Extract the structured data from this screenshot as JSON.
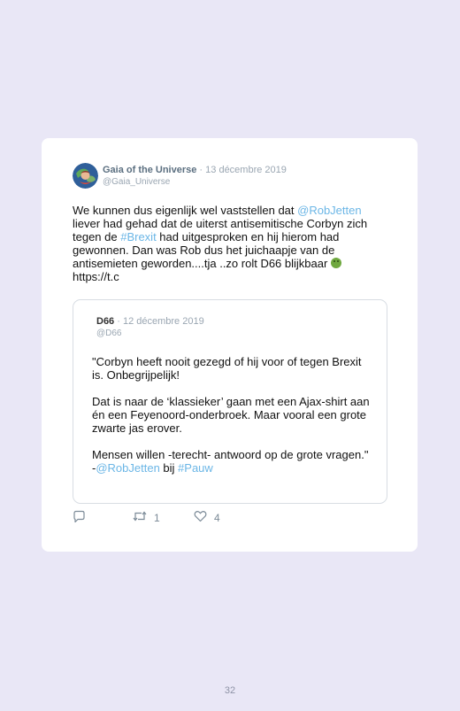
{
  "tweet": {
    "author_name": "Gaia of the Universe",
    "separator": " · ",
    "date": "13 décembre 2019",
    "handle": "@Gaia_Universe",
    "text": {
      "part1": "We kunnen dus eigenlijk wel vaststellen dat ",
      "mention_robjetten": "@RobJetten",
      "part2": " liever had gehad dat de uiterst antisemitische Corbyn zich tegen de ",
      "hashtag_brexit": "#Brexit",
      "part3": " had uitgesproken en hij hierom had gewonnen. Dan was Rob dus het juichaapje van de antisemieten geworden....tja ..zo rolt D66 blijkbaar ",
      "emoji": "nauseated-face-emoji",
      "url": "https://t.c"
    }
  },
  "quoted_tweet": {
    "author_name": "D66",
    "separator": " · ",
    "date": "12 décembre 2019",
    "handle": "@D66",
    "paragraphs": [
      "\"Corbyn heeft nooit gezegd of hij voor of tegen Brexit is. Onbegrijpelijk!",
      "Dat is naar de ‘klassieker’ gaan met een Ajax-shirt aan én een Feyenoord-onderbroek. Maar vooral een grote zwarte jas erover.",
      "Mensen willen -terecht- antwoord op de grote vragen.\""
    ],
    "signoff_prefix": "-",
    "mention_robjetten": "@RobJetten",
    "signoff_middle": " bij ",
    "hashtag_pauw": "#Pauw"
  },
  "actions": {
    "reply_icon": "reply-icon",
    "retweet_icon": "retweet-icon",
    "retweet_count": "1",
    "like_icon": "heart-icon",
    "like_count": "4"
  },
  "page_number": "32",
  "colors": {
    "background": "#e9e7f6",
    "card": "#ffffff",
    "link": "#6bb6e6",
    "muted": "#9aa6b2"
  }
}
